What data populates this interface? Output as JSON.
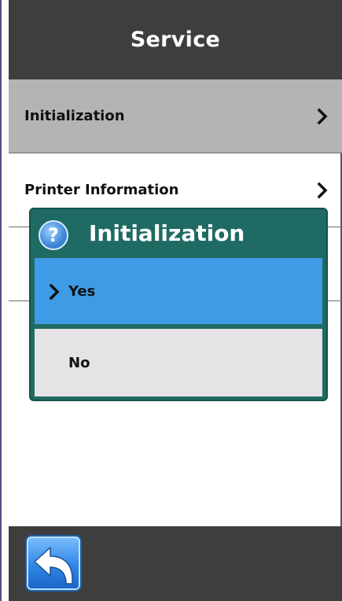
{
  "header": {
    "title": "Service"
  },
  "menu": {
    "items": [
      {
        "label": "Initialization",
        "selected": true
      },
      {
        "label": "Printer Information",
        "selected": false
      },
      {
        "label": "",
        "selected": false
      }
    ]
  },
  "dialog": {
    "title": "Initialization",
    "icon": "question-icon",
    "options": [
      {
        "label": "Yes",
        "selected": true
      },
      {
        "label": "No",
        "selected": false
      }
    ]
  },
  "footer": {
    "back_icon": "back-arrow-icon"
  },
  "colors": {
    "header_bg": "#3e3e3e",
    "selected_row_bg": "#b4b4b4",
    "dialog_bg": "#1f6b63",
    "selected_option_bg": "#3f9be6",
    "unselected_option_bg": "#e6e3e6"
  }
}
